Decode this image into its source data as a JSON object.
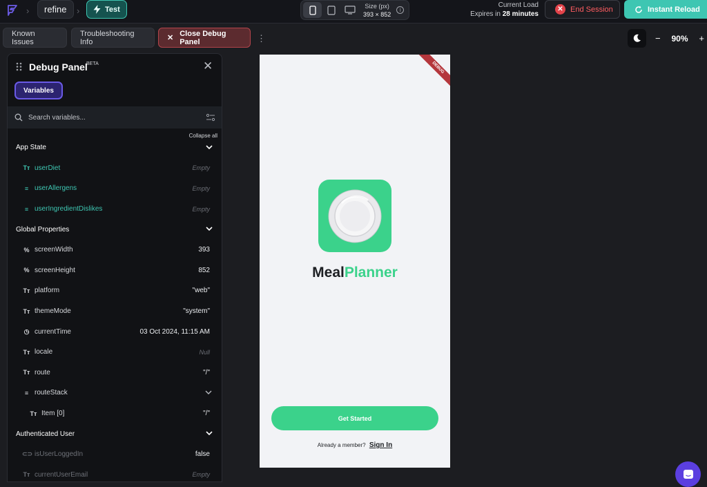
{
  "topbar": {
    "project_name": "refine",
    "branch_label": "Test",
    "size_label": "Size (px)",
    "size_value": "393 × 852",
    "load_label": "Current Load",
    "expires_prefix": "Expires in",
    "expires_value": "28 minutes",
    "end_session_label": "End Session",
    "instant_reload_label": "Instant Reload"
  },
  "toolbar": {
    "known_issues_label": "Known Issues",
    "troubleshooting_label": "Troubleshooting Info",
    "close_debug_label": "Close Debug Panel",
    "zoom_value": "90%"
  },
  "debug_panel": {
    "title": "Debug Panel",
    "badge": "BETA",
    "tab_variables": "Variables",
    "search_placeholder": "Search variables...",
    "collapse_all": "Collapse all",
    "rows": [
      {
        "type": "section",
        "label": "App State"
      },
      {
        "type": "item",
        "icon": "Tт",
        "label": "userDiet",
        "value": "Empty",
        "muted": true,
        "teal": true
      },
      {
        "type": "item",
        "icon": "≡",
        "label": "userAllergens",
        "value": "Empty",
        "muted": true,
        "teal": true
      },
      {
        "type": "item",
        "icon": "≡",
        "label": "userIngredientDislikes",
        "value": "Empty",
        "muted": true,
        "teal": true
      },
      {
        "type": "section",
        "label": "Global Properties"
      },
      {
        "type": "item",
        "icon": "%",
        "label": "screenWidth",
        "value": "393"
      },
      {
        "type": "item",
        "icon": "%",
        "label": "screenHeight",
        "value": "852"
      },
      {
        "type": "item",
        "icon": "Tт",
        "label": "platform",
        "value": "\"web\""
      },
      {
        "type": "item",
        "icon": "Tт",
        "label": "themeMode",
        "value": "\"system\""
      },
      {
        "type": "item",
        "icon": "◷",
        "label": "currentTime",
        "value": "03 Oct 2024, 11:15 AM"
      },
      {
        "type": "item",
        "icon": "Tт",
        "label": "locale",
        "value": "Null",
        "muted": true
      },
      {
        "type": "item",
        "icon": "Tт",
        "label": "route",
        "value": "\"/\""
      },
      {
        "type": "item",
        "icon": "≡",
        "label": "routeStack",
        "chevron": true
      },
      {
        "type": "item",
        "icon": "Tт",
        "label": "Item [0]",
        "value": "\"/\"",
        "nested": true
      },
      {
        "type": "section",
        "label": "Authenticated User"
      },
      {
        "type": "item",
        "icon": "⊂⊃",
        "label": "isUserLoggedIn",
        "value": "false",
        "dim": true
      },
      {
        "type": "item",
        "icon": "Tт",
        "label": "currentUserEmail",
        "value": "Empty",
        "muted": true,
        "dim": true
      }
    ]
  },
  "preview": {
    "debug_ribbon": "DEBUG",
    "brand_first": "Meal",
    "brand_second": "Planner",
    "get_started_label": "Get Started",
    "already_member": "Already a member?",
    "sign_in_label": "Sign In"
  },
  "colors": {
    "accent_teal": "#3ec6b2",
    "brand_green": "#3bd28b",
    "danger": "#e2434a",
    "variables_tab": "#6a5ae6"
  }
}
